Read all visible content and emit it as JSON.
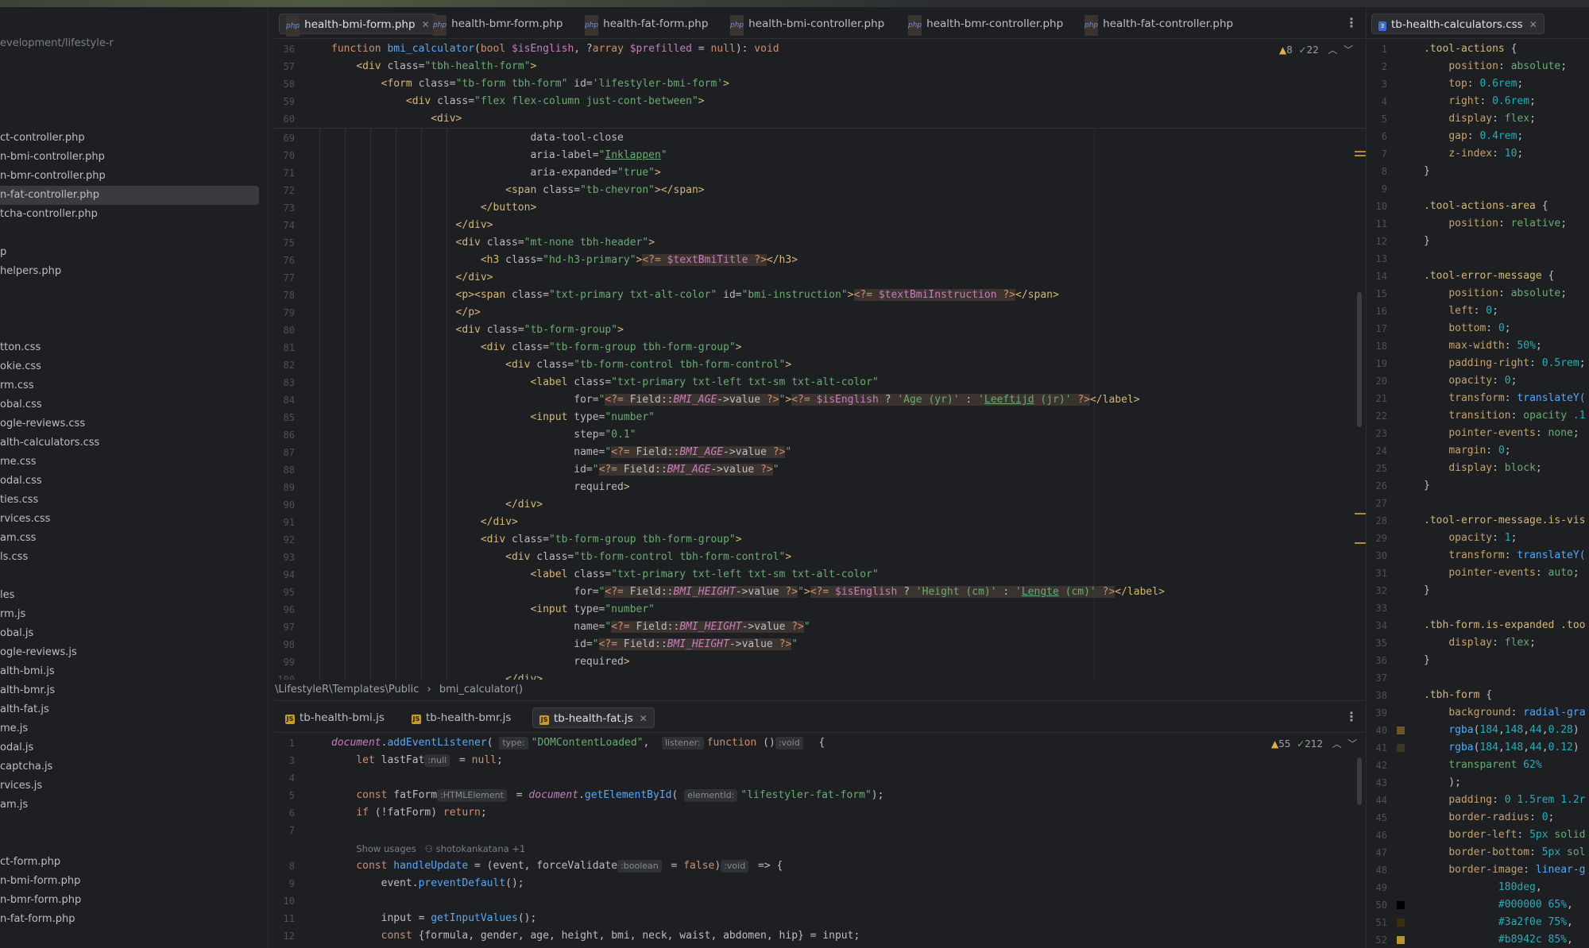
{
  "sidebar": {
    "path": "evelopment/lifestyle-r",
    "items": [
      {
        "label": "ct-controller.php"
      },
      {
        "label": "n-bmi-controller.php"
      },
      {
        "label": "n-bmr-controller.php"
      },
      {
        "label": "n-fat-controller.php",
        "selected": true
      },
      {
        "label": "tcha-controller.php"
      },
      {
        "label": "p"
      },
      {
        "label": "helpers.php"
      },
      {
        "label": "tton.css"
      },
      {
        "label": "okie.css"
      },
      {
        "label": "rm.css"
      },
      {
        "label": "obal.css"
      },
      {
        "label": "ogle-reviews.css"
      },
      {
        "label": "alth-calculators.css"
      },
      {
        "label": "me.css"
      },
      {
        "label": "odal.css"
      },
      {
        "label": "ties.css"
      },
      {
        "label": "rvices.css"
      },
      {
        "label": "am.css"
      },
      {
        "label": "ls.css"
      },
      {
        "label": "les"
      },
      {
        "label": "rm.js"
      },
      {
        "label": "obal.js"
      },
      {
        "label": "ogle-reviews.js"
      },
      {
        "label": "alth-bmi.js"
      },
      {
        "label": "alth-bmr.js"
      },
      {
        "label": "alth-fat.js"
      },
      {
        "label": "me.js"
      },
      {
        "label": "odal.js"
      },
      {
        "label": "captcha.js"
      },
      {
        "label": "rvices.js"
      },
      {
        "label": "am.js"
      },
      {
        "label": "ct-form.php"
      },
      {
        "label": "n-bmi-form.php"
      },
      {
        "label": "n-bmr-form.php"
      },
      {
        "label": "n-fat-form.php"
      }
    ]
  },
  "top_tabs": [
    {
      "label": "health-bmi-form.php",
      "active": true,
      "icon": "php-file-icon"
    },
    {
      "label": "health-bmr-form.php",
      "icon": "php-file-icon"
    },
    {
      "label": "health-fat-form.php",
      "icon": "php-file-icon"
    },
    {
      "label": "health-bmi-controller.php",
      "icon": "php-file-icon"
    },
    {
      "label": "health-bmr-controller.php",
      "icon": "php-file-icon"
    },
    {
      "label": "health-fat-controller.php",
      "icon": "php-file-icon"
    }
  ],
  "right_tab": {
    "label": "tb-health-calculators.css",
    "icon": "css-file-icon"
  },
  "bottom_tabs": [
    {
      "label": "tb-health-bmi.js",
      "icon": "js-file-icon"
    },
    {
      "label": "tb-health-bmr.js",
      "icon": "js-file-icon"
    },
    {
      "label": "tb-health-fat.js",
      "active": true,
      "icon": "js-file-icon"
    }
  ],
  "top_editor": {
    "warnings": "8",
    "checks": "22",
    "sticky": [
      {
        "n": "36",
        "html": "<span class='kw'>function</span> <span class='fn'>bmi_calculator</span>(<span class='kw'>bool</span> <span class='var'>$isEnglish</span>, ?<span class='kw'>array</span> <span class='var'>$prefilled</span> = <span class='kw'>null</span>): <span class='kw'>void</span>"
      },
      {
        "n": "57",
        "html": "    <span class='tag'>&lt;div</span> <span class='attr'>class=</span><span class='str'>\"tbh-health-form\"</span><span class='tag'>&gt;</span>"
      },
      {
        "n": "58",
        "html": "        <span class='tag'>&lt;form</span> <span class='attr'>class=</span><span class='str'>\"tb-form tbh-form\"</span> <span class='attr'>id=</span><span class='str'>'lifestyler-bmi-form'</span><span class='tag'>&gt;</span>"
      },
      {
        "n": "59",
        "html": "            <span class='tag'>&lt;div</span> <span class='attr'>class=</span><span class='str'>\"flex flex-column just-cont-between\"</span><span class='tag'>&gt;</span>"
      },
      {
        "n": "60",
        "html": "                <span class='tag'>&lt;div&gt;</span>"
      }
    ],
    "lines": [
      {
        "n": "69",
        "html": "                                <span class='attr'>data-tool-close</span>"
      },
      {
        "n": "70",
        "html": "                                <span class='attr'>aria-label=</span><span class='str'>\"<u>Inklappen</u>\"</span>"
      },
      {
        "n": "71",
        "html": "                                <span class='attr'>aria-expanded=</span><span class='str'>\"true\"</span><span class='tag'>&gt;</span>"
      },
      {
        "n": "72",
        "html": "                            <span class='tag'>&lt;span</span> <span class='attr'>class=</span><span class='str'>\"tb-chevron\"</span><span class='tag'>&gt;&lt;/span&gt;</span>"
      },
      {
        "n": "73",
        "html": "                        <span class='tag'>&lt;/button&gt;</span>"
      },
      {
        "n": "74",
        "html": "                    <span class='tag'>&lt;/div&gt;</span>"
      },
      {
        "n": "75",
        "html": "                    <span class='tag'>&lt;div</span> <span class='attr'>class=</span><span class='str'>\"mt-none tbh-header\"</span><span class='tag'>&gt;</span>"
      },
      {
        "n": "76",
        "html": "                        <span class='tag'>&lt;h3</span> <span class='attr'>class=</span><span class='str'>\"hd-h3-primary\"</span><span class='tag'>&gt;</span><span class='php'><span class='kw'>&lt;?=</span> <span class='var'>$textBmiTitle</span> <span class='kw'>?&gt;</span></span><span class='tag'>&lt;/h3&gt;</span>"
      },
      {
        "n": "77",
        "html": "                    <span class='tag'>&lt;/div&gt;</span>"
      },
      {
        "n": "78",
        "html": "                    <span class='tag'>&lt;p&gt;&lt;span</span> <span class='attr'>class=</span><span class='str'>\"txt-primary txt-alt-color\"</span> <span class='attr'>id=</span><span class='str'>\"bmi-instruction\"</span><span class='tag'>&gt;</span><span class='php'><span class='kw'>&lt;?=</span> <span class='var'>$textBmiInstruction</span> <span class='kw'>?&gt;</span></span><span class='tag'>&lt;/span&gt;</span>"
      },
      {
        "n": "79",
        "html": "                    <span class='tag'>&lt;/p&gt;</span>"
      },
      {
        "n": "80",
        "html": "                    <span class='tag'>&lt;div</span> <span class='attr'>class=</span><span class='str'>\"tb-form-group\"</span><span class='tag'>&gt;</span>"
      },
      {
        "n": "81",
        "html": "                        <span class='tag'>&lt;div</span> <span class='attr'>class=</span><span class='str'>\"tb-form-group tbh-form-group\"</span><span class='tag'>&gt;</span>"
      },
      {
        "n": "82",
        "html": "                            <span class='tag'>&lt;div</span> <span class='attr'>class=</span><span class='str'>\"tb-form-control tbh-form-control\"</span><span class='tag'>&gt;</span>"
      },
      {
        "n": "83",
        "html": "                                <span class='tag'>&lt;label</span> <span class='attr'>class=</span><span class='str'>\"txt-primary txt-left txt-sm txt-alt-color\"</span>"
      },
      {
        "n": "84",
        "html": "                                       <span class='attr'>for=</span><span class='str'>\"</span><span class='php'><span class='kw'>&lt;?=</span> Field::<span class='const'>BMI_AGE</span>-&gt;value <span class='kw'>?&gt;</span></span><span class='str'>\"</span><span class='tag'>&gt;</span><span class='php'><span class='kw'>&lt;?=</span> <span class='var'>$isEnglish</span> ? <span class='str'>'Age (yr)'</span> : <span class='str'>'<u>Leeftijd</u> (jr)'</span> <span class='kw'>?&gt;</span></span><span class='tag'>&lt;/label&gt;</span>"
      },
      {
        "n": "85",
        "html": "                                <span class='tag'>&lt;input</span> <span class='attr'>type=</span><span class='str'>\"number\"</span>"
      },
      {
        "n": "86",
        "html": "                                       <span class='attr'>step=</span><span class='str'>\"0.1\"</span>"
      },
      {
        "n": "87",
        "html": "                                       <span class='attr'>name=</span><span class='str'>\"</span><span class='php'><span class='kw'>&lt;?=</span> Field::<span class='const'>BMI_AGE</span>-&gt;value <span class='kw'>?&gt;</span></span><span class='str'>\"</span>"
      },
      {
        "n": "88",
        "html": "                                       <span class='attr'>id=</span><span class='str'>\"</span><span class='php'><span class='kw'>&lt;?=</span> Field::<span class='const'>BMI_AGE</span>-&gt;value <span class='kw'>?&gt;</span></span><span class='str'>\"</span>"
      },
      {
        "n": "89",
        "html": "                                       <span class='attr'>required</span><span class='tag'>&gt;</span>"
      },
      {
        "n": "90",
        "html": "                            <span class='tag'>&lt;/div&gt;</span>"
      },
      {
        "n": "91",
        "html": "                        <span class='tag'>&lt;/div&gt;</span>"
      },
      {
        "n": "92",
        "html": "                        <span class='tag'>&lt;div</span> <span class='attr'>class=</span><span class='str'>\"tb-form-group tbh-form-group\"</span><span class='tag'>&gt;</span>"
      },
      {
        "n": "93",
        "html": "                            <span class='tag'>&lt;div</span> <span class='attr'>class=</span><span class='str'>\"tb-form-control tbh-form-control\"</span><span class='tag'>&gt;</span>"
      },
      {
        "n": "94",
        "html": "                                <span class='tag'>&lt;label</span> <span class='attr'>class=</span><span class='str'>\"txt-primary txt-left txt-sm txt-alt-color\"</span>"
      },
      {
        "n": "95",
        "html": "                                       <span class='attr'>for=</span><span class='str'>\"</span><span class='php'><span class='kw'>&lt;?=</span> Field::<span class='const'>BMI_HEIGHT</span>-&gt;value <span class='kw'>?&gt;</span></span><span class='str'>\"</span><span class='tag'>&gt;</span><span class='php'><span class='kw'>&lt;?=</span> <span class='var'>$isEnglish</span> ? <span class='str'>'Height (cm)'</span> : <span class='str'>'<u>Lengte</u> (cm)'</span> <span class='kw'>?&gt;</span></span><span class='tag'>&lt;/label&gt;</span>"
      },
      {
        "n": "96",
        "html": "                                <span class='tag'>&lt;input</span> <span class='attr'>type=</span><span class='str'>\"number\"</span>"
      },
      {
        "n": "97",
        "html": "                                       <span class='attr'>name=</span><span class='str'>\"</span><span class='php'><span class='kw'>&lt;?=</span> Field::<span class='const'>BMI_HEIGHT</span>-&gt;value <span class='kw'>?&gt;</span></span><span class='str'>\"</span>"
      },
      {
        "n": "98",
        "html": "                                       <span class='attr'>id=</span><span class='str'>\"</span><span class='php'><span class='kw'>&lt;?=</span> Field::<span class='const'>BMI_HEIGHT</span>-&gt;value <span class='kw'>?&gt;</span></span><span class='str'>\"</span>"
      },
      {
        "n": "99",
        "html": "                                       <span class='attr'>required</span><span class='tag'>&gt;</span>"
      },
      {
        "n": "100",
        "html": "                            <span class='tag'>&lt;/div&gt;</span>"
      }
    ]
  },
  "breadcrumb": {
    "path": "\\LifestyleR\\Templates\\Public",
    "sep": "›",
    "fn": "bmi_calculator()"
  },
  "bottom_editor": {
    "warnings": "55",
    "checks": "212",
    "lines": [
      {
        "n": "1",
        "html": "<span class='prop italic'>document</span>.<span class='fn'>addEventListener</span>( <span class='hint'>type:</span><span class='str'>\"DOMContentLoaded\"</span>,  <span class='hint'>listener:</span><span class='kw'>function</span> ()<span class='hint'>:void</span>  {"
      },
      {
        "n": "3",
        "html": "    <span class='kw'>let</span> lastFat<span class='hint'>:null</span> = <span class='kw'>null</span>;"
      },
      {
        "n": "4",
        "html": ""
      },
      {
        "n": "5",
        "html": "    <span class='kw'>const</span> fatForm<span class='hint'>:HTMLElement</span> = <span class='prop italic'>document</span>.<span class='fn'>getElementById</span>( <span class='hint'>elementId:</span><span class='str'>\"lifestyler-fat-form\"</span>);"
      },
      {
        "n": "6",
        "html": "    <span class='kw'>if</span> (!fatForm) <span class='kw'>return</span>;"
      },
      {
        "n": "7",
        "html": ""
      },
      {
        "n": "",
        "html": "    <span class='com' style='font-family:\"DejaVu Sans\",sans-serif;font-size:11.5px'>Show usages   ⚇ shotokankatana +1</span>"
      },
      {
        "n": "8",
        "html": "    <span class='kw'>const</span> <span class='fn'>handleUpdate</span> = (event, forceValidate<span class='hint'>:boolean</span> = <span class='kw'>false</span>)<span class='hint'>:void</span> =&gt; {"
      },
      {
        "n": "9",
        "html": "        event.<span class='fn'>preventDefault</span>();"
      },
      {
        "n": "10",
        "html": ""
      },
      {
        "n": "11",
        "html": "        input = <span class='fn'>getInputValues</span>();"
      },
      {
        "n": "12",
        "html": "        <span class='kw'>const</span> {formula, gender, age, height, bmi, neck, waist, abdomen, hip} = input;"
      }
    ]
  },
  "css_editor": {
    "lines": [
      {
        "n": "1",
        "html": "<span class='sel'>.tool-actions</span> {"
      },
      {
        "n": "2",
        "html": "    <span class='cssprop'>position</span>: <span class='str'>absolute</span>;"
      },
      {
        "n": "3",
        "html": "    <span class='cssprop'>top</span>: <span class='num'>0.6rem</span>;"
      },
      {
        "n": "4",
        "html": "    <span class='cssprop'>right</span>: <span class='num'>0.6rem</span>;"
      },
      {
        "n": "5",
        "html": "    <span class='cssprop'>display</span>: <span class='str'>flex</span>;"
      },
      {
        "n": "6",
        "html": "    <span class='cssprop'>gap</span>: <span class='num'>0.4rem</span>;"
      },
      {
        "n": "7",
        "html": "    <span class='cssprop'>z-index</span>: <span class='num'>10</span>;"
      },
      {
        "n": "8",
        "html": "}"
      },
      {
        "n": "9",
        "html": ""
      },
      {
        "n": "10",
        "html": "<span class='sel'>.tool-actions-area</span> {"
      },
      {
        "n": "11",
        "html": "    <span class='cssprop'>position</span>: <span class='str'>relative</span>;"
      },
      {
        "n": "12",
        "html": "}"
      },
      {
        "n": "13",
        "html": ""
      },
      {
        "n": "14",
        "html": "<span class='sel'>.tool-error-message</span> {"
      },
      {
        "n": "15",
        "html": "    <span class='cssprop'>position</span>: <span class='str'>absolute</span>;"
      },
      {
        "n": "16",
        "html": "    <span class='cssprop'>left</span>: <span class='num'>0</span>;"
      },
      {
        "n": "17",
        "html": "    <span class='cssprop'>bottom</span>: <span class='num'>0</span>;"
      },
      {
        "n": "18",
        "html": "    <span class='cssprop'>max-width</span>: <span class='num'>50%</span>;"
      },
      {
        "n": "19",
        "html": "    <span class='cssprop'>padding-right</span>: <span class='num'>0.5rem</span>;"
      },
      {
        "n": "20",
        "html": "    <span class='cssprop'>opacity</span>: <span class='num'>0</span>;"
      },
      {
        "n": "21",
        "html": "    <span class='cssprop'>transform</span>: <span class='fn'>translateY(</span>"
      },
      {
        "n": "22",
        "html": "    <span class='cssprop'>transition</span>: <span class='str'>opacity</span> <span class='num'>.1</span>"
      },
      {
        "n": "23",
        "html": "    <span class='cssprop'>pointer-events</span>: <span class='str'>none</span>;"
      },
      {
        "n": "24",
        "html": "    <span class='cssprop'>margin</span>: <span class='num'>0</span>;"
      },
      {
        "n": "25",
        "html": "    <span class='cssprop'>display</span>: <span class='str'>block</span>;"
      },
      {
        "n": "26",
        "html": "}"
      },
      {
        "n": "27",
        "html": ""
      },
      {
        "n": "28",
        "html": "<span class='sel'>.tool-error-message.is-vis</span>"
      },
      {
        "n": "29",
        "html": "    <span class='cssprop'>opacity</span>: <span class='num'>1</span>;"
      },
      {
        "n": "30",
        "html": "    <span class='cssprop'>transform</span>: <span class='fn'>translateY(</span>"
      },
      {
        "n": "31",
        "html": "    <span class='cssprop'>pointer-events</span>: <span class='str'>auto</span>;"
      },
      {
        "n": "32",
        "html": "}"
      },
      {
        "n": "33",
        "html": ""
      },
      {
        "n": "34",
        "html": "<span class='sel'>.tbh-form.is-expanded .too</span>"
      },
      {
        "n": "35",
        "html": "    <span class='cssprop'>display</span>: <span class='str'>flex</span>;"
      },
      {
        "n": "36",
        "html": "}"
      },
      {
        "n": "37",
        "html": ""
      },
      {
        "n": "38",
        "html": "<span class='sel'>.tbh-form</span> {"
      },
      {
        "n": "39",
        "html": "    <span class='cssprop'>background</span>: <span class='fn'>radial-gra</span>"
      },
      {
        "n": "40",
        "html": "    <span class='fn'>rgba</span>(<span class='num'>184</span>,<span class='num'>148</span>,<span class='num'>44</span>,<span class='num'>0.28</span>)",
        "swatch": "#6b5628"
      },
      {
        "n": "41",
        "html": "    <span class='fn'>rgba</span>(<span class='num'>184</span>,<span class='num'>148</span>,<span class='num'>44</span>,<span class='num'>0.12</span>)",
        "swatch": "#3e3522"
      },
      {
        "n": "42",
        "html": "    <span class='str'>transparent</span> <span class='num'>62%</span>"
      },
      {
        "n": "43",
        "html": "    );"
      },
      {
        "n": "44",
        "html": "    <span class='cssprop'>padding</span>: <span class='num'>0 1.5rem 1.2r</span>"
      },
      {
        "n": "45",
        "html": "    <span class='cssprop'>border-radius</span>: <span class='num'>0</span>;"
      },
      {
        "n": "46",
        "html": "    <span class='cssprop'>border-left</span>: <span class='num'>5px</span> <span class='str'>solid</span>"
      },
      {
        "n": "47",
        "html": "    <span class='cssprop'>border-bottom</span>: <span class='num'>5px</span> <span class='str'>sol</span>"
      },
      {
        "n": "48",
        "html": "    <span class='cssprop'>border-image</span>: <span class='fn'>linear-g</span>"
      },
      {
        "n": "49",
        "html": "            <span class='num'>180deg</span>,"
      },
      {
        "n": "50",
        "html": "            <span class='num'>#000000</span> <span class='num'>65%</span>,",
        "swatch": "#000000"
      },
      {
        "n": "51",
        "html": "            <span class='num'>#3a2f0e</span> <span class='num'>75%</span>,",
        "swatch": "#3a2f0e"
      },
      {
        "n": "52",
        "html": "            <span class='num'>#b8942c</span> <span class='num'>85%</span>,",
        "swatch": "#b8942c"
      }
    ]
  }
}
